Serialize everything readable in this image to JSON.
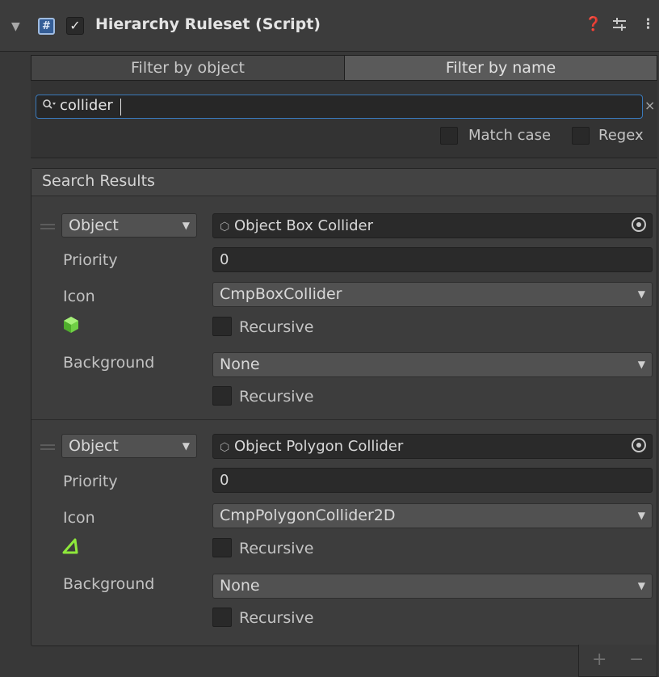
{
  "component": {
    "title": "Hierarchy Ruleset (Script)",
    "enabled_mark": "✓",
    "script_icon_glyph": "#",
    "foldout_icon": "triangle-down-icon",
    "help_icon": "question-circle-icon",
    "presets_icon": "sliders-icon",
    "menu_icon": "kebab-menu-icon"
  },
  "tabs": [
    {
      "label": "Filter by object",
      "selected": false
    },
    {
      "label": "Filter by name",
      "selected": true
    }
  ],
  "search": {
    "value": "collider",
    "icon": "search-icon",
    "clear_glyph": "×",
    "options": {
      "match_case": "Match case",
      "regex": "Regex"
    }
  },
  "results": {
    "title": "Search Results",
    "rules": [
      {
        "type": "Object",
        "object": "Object Box Collider",
        "priority_label": "Priority",
        "priority": "0",
        "icon_label": "Icon",
        "icon_value": "CmpBoxCollider",
        "icon_preview": "box-collider-icon",
        "icon_color": "#7ed957",
        "background_label": "Background",
        "background_value": "None",
        "recursive_label": "Recursive"
      },
      {
        "type": "Object",
        "object": "Object Polygon Collider",
        "priority_label": "Priority",
        "priority": "0",
        "icon_label": "Icon",
        "icon_value": "CmpPolygonCollider2D",
        "icon_preview": "polygon-collider-icon",
        "icon_color": "#8ee83b",
        "background_label": "Background",
        "background_value": "None",
        "recursive_label": "Recursive"
      }
    ]
  },
  "footer": {
    "add": "+",
    "remove": "−"
  },
  "colors": {
    "accent": "#3a79bb",
    "panel": "#383838",
    "field": "#2a2a2a"
  }
}
